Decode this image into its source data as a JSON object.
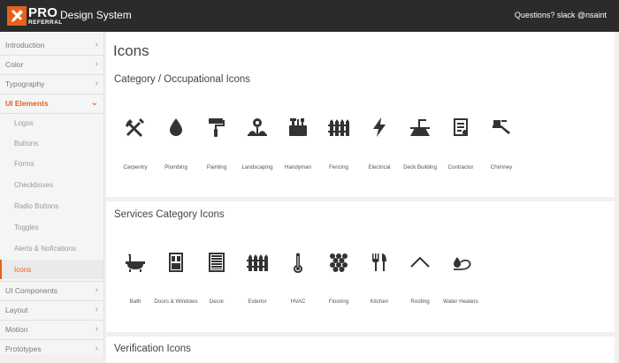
{
  "header": {
    "logo_text": "PRO",
    "logo_sub": "REFERRAL",
    "app_title": "Design System",
    "help_text": "Questions? slack @nsaint"
  },
  "sidebar": {
    "items": [
      {
        "label": "Introduction"
      },
      {
        "label": "Color"
      },
      {
        "label": "Typography"
      },
      {
        "label": "UI Elements",
        "active": true
      },
      {
        "label": "UI Components"
      },
      {
        "label": "Layout"
      },
      {
        "label": "Motion"
      },
      {
        "label": "Prototypes"
      }
    ],
    "subitems": [
      {
        "label": "Logos"
      },
      {
        "label": "Buttons"
      },
      {
        "label": "Forms"
      },
      {
        "label": "Checkboxes"
      },
      {
        "label": "Radio Buttons"
      },
      {
        "label": "Toggles"
      },
      {
        "label": "Alerts & Nofications"
      },
      {
        "label": "Icons",
        "selected": true
      }
    ]
  },
  "main": {
    "page_title": "Icons",
    "sections": [
      {
        "title": "Category / Occupational Icons",
        "icons": [
          {
            "label": "Carpentry",
            "icon": "carpentry-icon"
          },
          {
            "label": "Plumbing",
            "icon": "plumbing-icon"
          },
          {
            "label": "Painting",
            "icon": "painting-icon"
          },
          {
            "label": "Landscaping",
            "icon": "landscaping-icon"
          },
          {
            "label": "Handyman",
            "icon": "handyman-icon"
          },
          {
            "label": "Fencing",
            "icon": "fencing-icon"
          },
          {
            "label": "Electrical",
            "icon": "electrical-icon"
          },
          {
            "label": "Deck Building",
            "icon": "deck-building-icon"
          },
          {
            "label": "Contractor",
            "icon": "contractor-icon"
          },
          {
            "label": "Chimney",
            "icon": "chimney-icon"
          }
        ]
      },
      {
        "title": "Services Category Icons",
        "icons": [
          {
            "label": "Bath",
            "icon": "bath-icon"
          },
          {
            "label": "Doors & Windows",
            "icon": "doors-windows-icon"
          },
          {
            "label": "Decor",
            "icon": "decor-icon"
          },
          {
            "label": "Exterior",
            "icon": "exterior-icon"
          },
          {
            "label": "HVAC",
            "icon": "hvac-icon"
          },
          {
            "label": "Flooring",
            "icon": "flooring-icon"
          },
          {
            "label": "Kitchen",
            "icon": "kitchen-icon"
          },
          {
            "label": "Roofing",
            "icon": "roofing-icon"
          },
          {
            "label": "Water Heaters",
            "icon": "water-heaters-icon"
          }
        ]
      },
      {
        "title": "Verification Icons",
        "icons": []
      }
    ]
  },
  "colors": {
    "brand_orange": "#e8611a",
    "topbar": "#2b2b2b",
    "icon": "#333333"
  }
}
